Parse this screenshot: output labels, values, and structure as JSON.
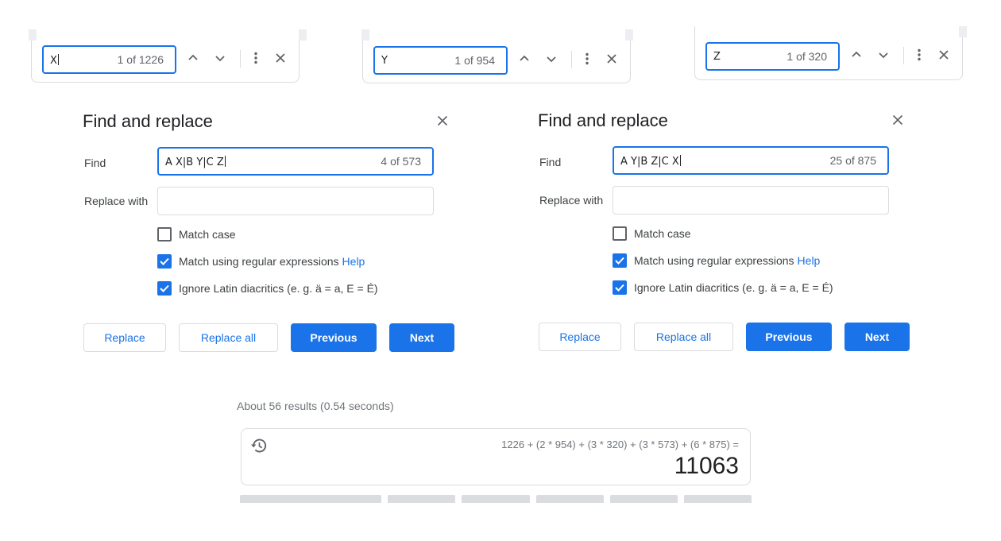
{
  "findbars": [
    {
      "query": "X",
      "count": "1 of 1226"
    },
    {
      "query": "Y",
      "count": "1 of 954"
    },
    {
      "query": "Z",
      "count": "1 of 320"
    }
  ],
  "findbar_icons": [
    "chevron-up-icon",
    "chevron-down-icon",
    "more-vert-icon",
    "close-icon"
  ],
  "dialogs": [
    {
      "title": "Find and replace",
      "find_label": "Find",
      "find_value": "A X|B Y|C Z",
      "find_count": "4 of 573",
      "replace_label": "Replace with",
      "replace_value": "",
      "match_case": "Match case",
      "match_case_checked": false,
      "regex": "Match using regular expressions",
      "regex_checked": true,
      "help": "Help",
      "diacritics": "Ignore Latin diacritics (e. g. ä = a, E = É)",
      "diacritics_checked": true,
      "replace_btn": "Replace",
      "replace_all_btn": "Replace all",
      "previous_btn": "Previous",
      "next_btn": "Next"
    },
    {
      "title": "Find and replace",
      "find_label": "Find",
      "find_value": "A Y|B Z|C X",
      "find_count": "25 of 875",
      "replace_label": "Replace with",
      "replace_value": "",
      "match_case": "Match case",
      "match_case_checked": false,
      "regex": "Match using regular expressions",
      "regex_checked": true,
      "help": "Help",
      "diacritics": "Ignore Latin diacritics (e. g. ä = a, E = É)",
      "diacritics_checked": true,
      "replace_btn": "Replace",
      "replace_all_btn": "Replace all",
      "previous_btn": "Previous",
      "next_btn": "Next"
    }
  ],
  "search": {
    "results_stats": "About 56 results (0.54 seconds)"
  },
  "calculator": {
    "expression": "1226 + (2 * 954) + (3 * 320) + (3 * 573) + (6 * 875) =",
    "result": "11063",
    "history_icon": "history-icon"
  },
  "colors": {
    "accent": "#1a73e8",
    "border": "#dadce0",
    "text": "#202124",
    "muted": "#5f6368"
  }
}
